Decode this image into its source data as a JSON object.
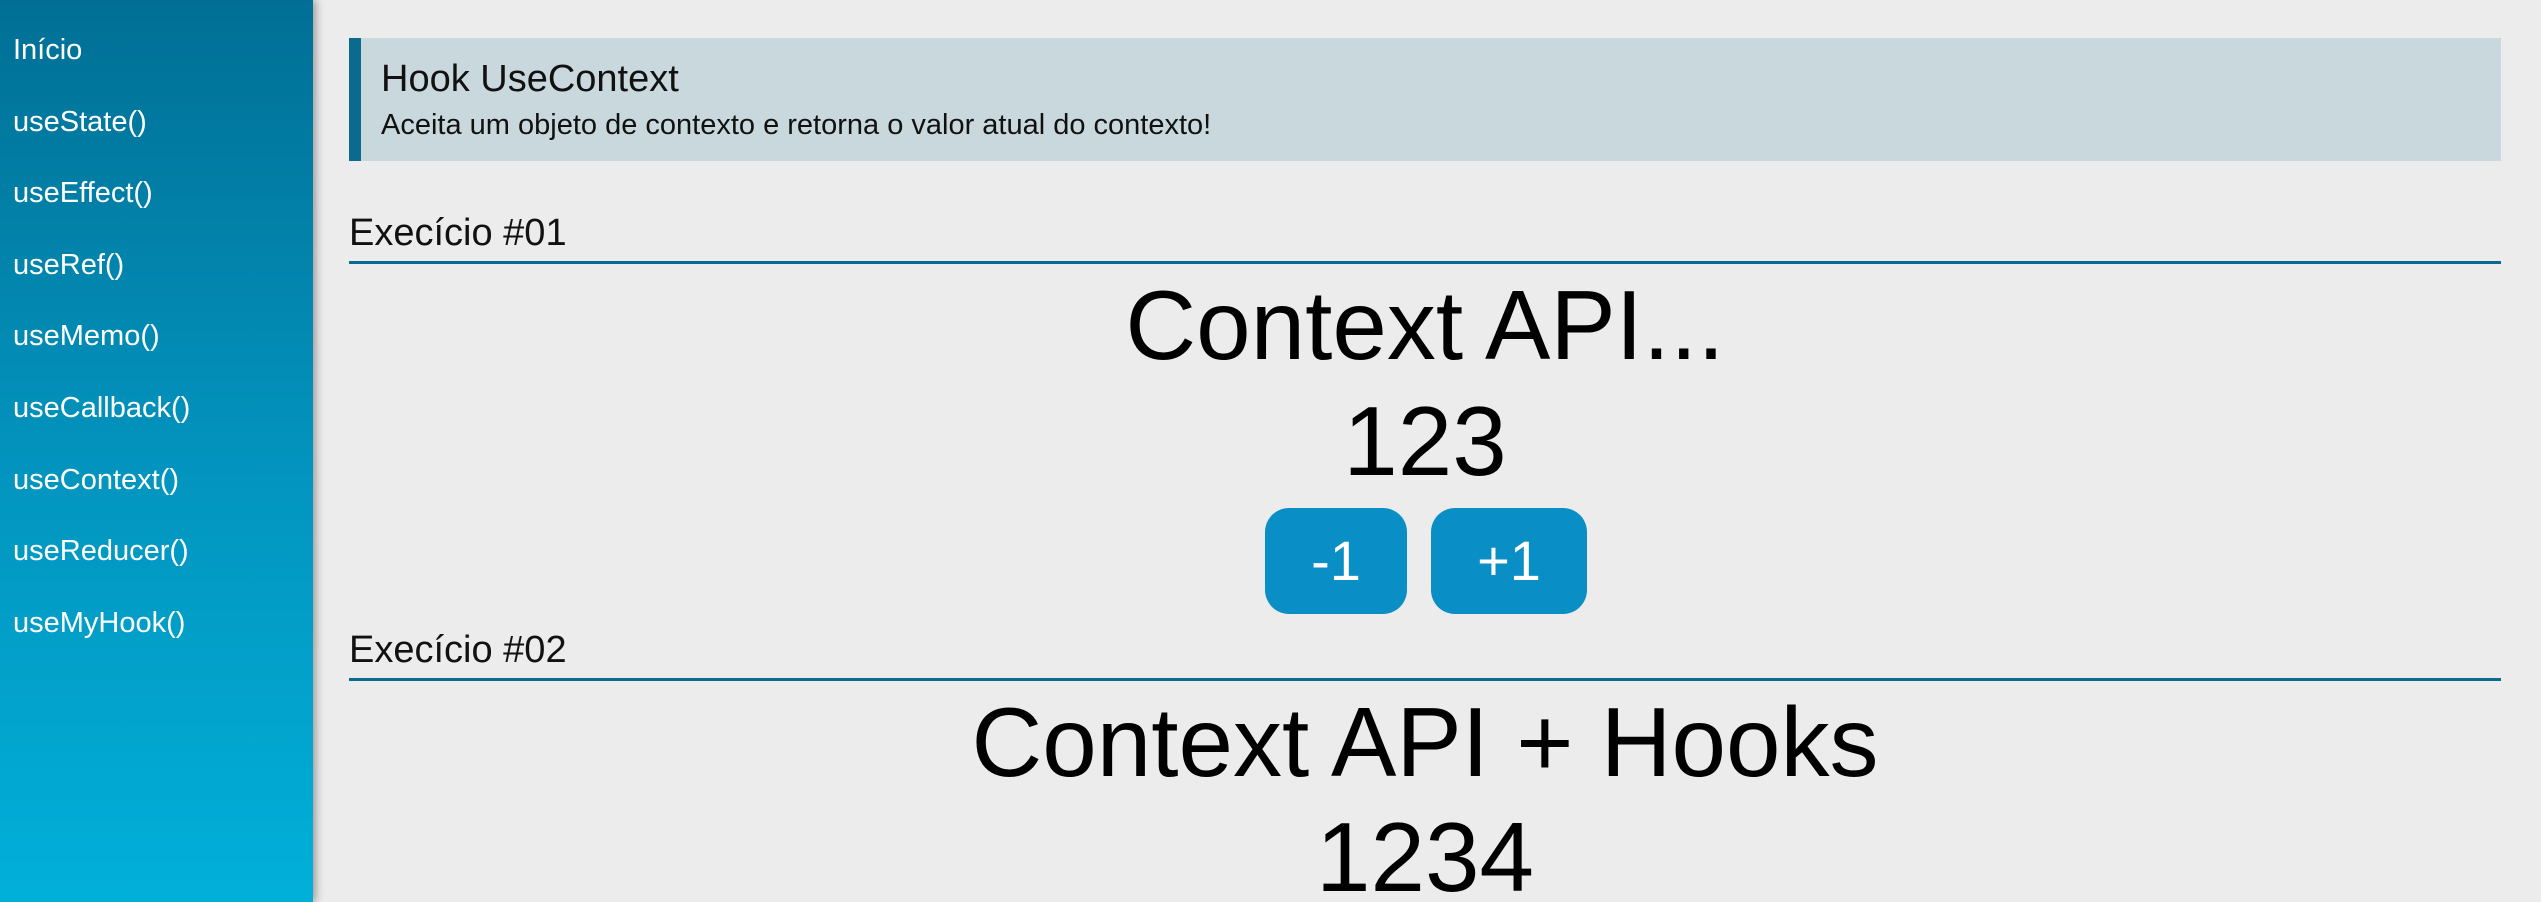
{
  "sidebar": {
    "items": [
      {
        "label": "Início"
      },
      {
        "label": "useState()"
      },
      {
        "label": "useEffect()"
      },
      {
        "label": "useRef()"
      },
      {
        "label": "useMemo()"
      },
      {
        "label": "useCallback()"
      },
      {
        "label": "useContext()"
      },
      {
        "label": "useReducer()"
      },
      {
        "label": "useMyHook()"
      }
    ]
  },
  "header": {
    "title": "Hook UseContext",
    "subtitle": "Aceita um objeto de contexto e retorna o valor atual do contexto!"
  },
  "exercise1": {
    "title": "Execício #01",
    "heading": "Context API...",
    "value": "123",
    "decrement_label": "-1",
    "increment_label": "+1"
  },
  "exercise2": {
    "title": "Execício #02",
    "heading": "Context API + Hooks",
    "value": "1234"
  },
  "colors": {
    "sidebar_top": "#016f95",
    "sidebar_bottom": "#01b0d9",
    "accent": "#0a6b8f",
    "button": "#0a8ec6",
    "header_bg": "#c9d8dd",
    "page_bg": "#ececec"
  }
}
